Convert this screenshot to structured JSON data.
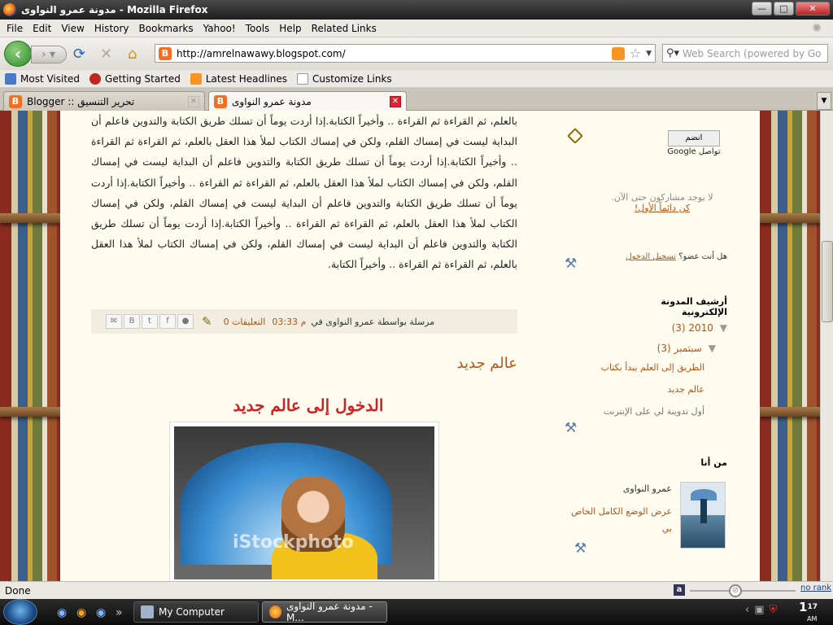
{
  "window": {
    "title": "مدونة عمرو النواوى - Mozilla Firefox"
  },
  "menu": [
    "File",
    "Edit",
    "View",
    "History",
    "Bookmarks",
    "Yahoo!",
    "Tools",
    "Help",
    "Related Links"
  ],
  "nav": {
    "url": "http://amrelnawawy.blogspot.com/",
    "search_placeholder": "Web Search (powered by Go"
  },
  "bookmarks": [
    {
      "label": "Most Visited",
      "icon": "most-visited-icon",
      "color": "#4a7ac7"
    },
    {
      "label": "Getting Started",
      "icon": "firefox-red-icon",
      "color": "#c0271f"
    },
    {
      "label": "Latest Headlines",
      "icon": "rss-icon",
      "color": "#f79422"
    },
    {
      "label": "Customize Links",
      "icon": "page-icon",
      "color": "#e8e8e8"
    }
  ],
  "tabs": [
    {
      "label": "Blogger :: تحرير التنسيق"
    },
    {
      "label": "مدونة عمرو النواوى"
    }
  ],
  "post": {
    "paragraph": "بالعلم، ثم القراءة ثم القراءة .. وأخيراً الكتابة.إذا أردت يوماً أن تسلك طريق الكتابة والتدوين فاعلم أن البداية ليست في إمساك القلم، ولكن في إمساك الكتاب لملأ هذا العقل بالعلم، ثم القراءة ثم القراءة .. وأخيراً الكتابة.إذا أردت يوماً أن تسلك طريق الكتابة والتدوين فاعلم أن البداية ليست في إمساك القلم، ولكن في إمساك الكتاب لملأ هذا العقل بالعلم، ثم القراءة ثم القراءة .. وأخيراً الكتابة.إذا أردت يوماً أن تسلك طريق الكتابة والتدوين فاعلم أن البداية ليست في إمساك القلم، ولكن في إمساك الكتاب لملأ هذا العقل بالعلم، ثم القراءة ثم القراءة .. وأخيراً الكتابة.إذا أردت يوماً أن تسلك طريق الكتابة والتدوين فاعلم أن البداية ليست في إمساك القلم، ولكن في إمساك الكتاب لملأ هذا العقل بالعلم، ثم القراءة ثم القراءة .. وأخيراً الكتابة.",
    "footer_by": "مرسلة بواسطة عمرو النواوى في",
    "footer_time": "03:33 م",
    "footer_comments": "0 التعليقات",
    "next_title": "عالم جديد",
    "next_heading": "الدخول إلى عالم جديد",
    "watermark": "iStockphoto"
  },
  "sidebar": {
    "gfc_button": "انضم",
    "gfc_label": "Google تواصل",
    "no_followers": "لا يوجد مشاركون حتى الآن.",
    "be_first": "كن دائماً الأول!",
    "member_q": "هل أنت عضو؟",
    "signin": "تسجيل الدخول",
    "archive_title": "أرشيف المدونة الإلكترونية",
    "archive_year": "2010 (3)",
    "archive_month": "سبتمبر (3)",
    "archive_posts": [
      "الطريق إلى العلم يبدأ بكتاب",
      "عالم جديد",
      "أول تدوينة لي على الإنترنت"
    ],
    "about_title": "من أنا",
    "about_name": "عمرو النواوى",
    "about_link": "عرض الوضع الكامل الخاص بي"
  },
  "status": {
    "text": "Done",
    "rank": "no rank"
  },
  "taskbar": {
    "buttons": [
      "My Computer",
      "مدونة عمرو النواوى - M..."
    ],
    "clock": "17",
    "clock_suffix": "AM",
    "clock_hour": "1"
  }
}
